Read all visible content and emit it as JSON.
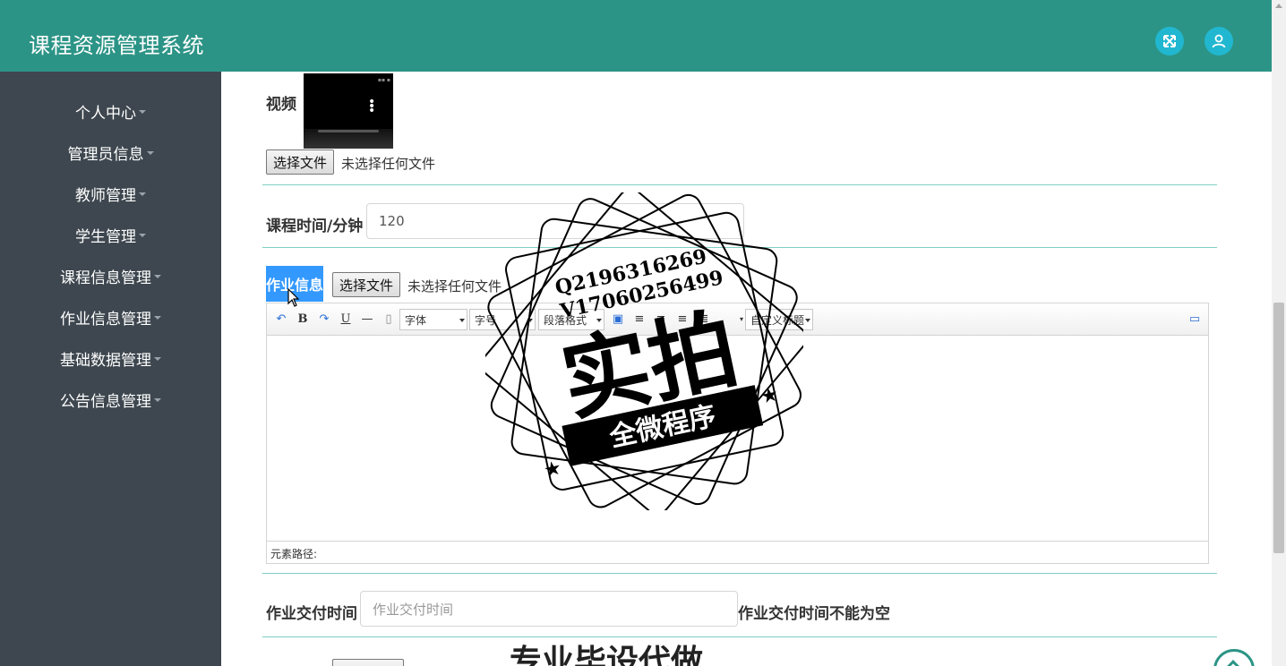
{
  "app": {
    "title": "课程资源管理系统"
  },
  "header": {
    "fullscreen_icon": "expand-icon",
    "user_icon": "user-icon",
    "accent": "#2c9486"
  },
  "sidebar": {
    "items": [
      {
        "label": "个人中心"
      },
      {
        "label": "管理员信息"
      },
      {
        "label": "教师管理"
      },
      {
        "label": "学生管理"
      },
      {
        "label": "课程信息管理"
      },
      {
        "label": "作业信息管理"
      },
      {
        "label": "基础数据管理"
      },
      {
        "label": "公告信息管理"
      }
    ]
  },
  "form": {
    "video": {
      "label": "视频",
      "file_button": "选择文件",
      "file_status": "未选择任何文件"
    },
    "duration": {
      "label": "课程时间/分钟",
      "value": "120"
    },
    "homework": {
      "label": "作业信息",
      "file_button": "选择文件",
      "file_status": "未选择任何文件",
      "editor": {
        "font_select": "字体",
        "size_select": "字号",
        "paragraph_select": "段落格式",
        "custom_title_select": "自定义标题",
        "path_label": "元素路径:"
      }
    },
    "deadline": {
      "label": "作业交付时间",
      "placeholder": "作业交付时间",
      "error": "作业交付时间不能为空"
    }
  },
  "watermark": {
    "qq": "Q2196316269",
    "vx": "V17060256499",
    "big": "实拍",
    "ribbon": "全微程序",
    "bottom": "专业毕设代做"
  }
}
